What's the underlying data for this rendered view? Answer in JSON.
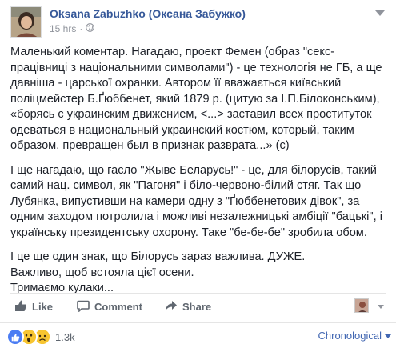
{
  "post": {
    "author": "Oksana Zabuzhko (Оксана Забужко)",
    "timestamp": "15 hrs",
    "separator": "·",
    "paragraphs": [
      "Маленький коментар. Нагадаю, проект Фемен (образ \"секс-працівниці з національними символами\") - це технологія не ГБ, а ще давніша - царської охранки. Автором її вважається київський поліцмейстер Б.Ґюббенет, який 1879 р. (цитую за І.П.Білоконським), «борясь с украинским движением, <...> заставил всех проституток одеваться в национальный украинский костюм, который, таким образом, превращен был в признак разврата...» (с)",
      "І ще нагадаю, що гасло \"Жыве Беларусь!\" - це, для білорусів, такий самий нац. символ, як \"Пагоня\" і біло-червоно-білий стяг. Так що Лубянка, випустивши на камери одну з \"Ґюббенетових дівок\", за одним заходом потролила і можливі незалежницькі амбіції \"бацькі\", і українську президентську охорону. Таке \"бе-бе-бе\" зробила обом.",
      "І це ще один знак, що Білорусь зараз важлива. ДУЖЕ.\nВажливо, щоб встояла цієї осени.\nТримаємо кулаки..."
    ]
  },
  "actions": {
    "like": "Like",
    "comment": "Comment",
    "share": "Share"
  },
  "reactions": {
    "count": "1.3k",
    "icons": [
      "like-reaction-icon",
      "wow-reaction-icon",
      "sad-reaction-icon"
    ]
  },
  "sort": {
    "label": "Chronological"
  },
  "colors": {
    "author_link": "#365899",
    "action_text": "#606770",
    "sort_link": "#4267b2",
    "like_blue": "#4a7cf3",
    "reaction_yellow": "#f7c531"
  }
}
